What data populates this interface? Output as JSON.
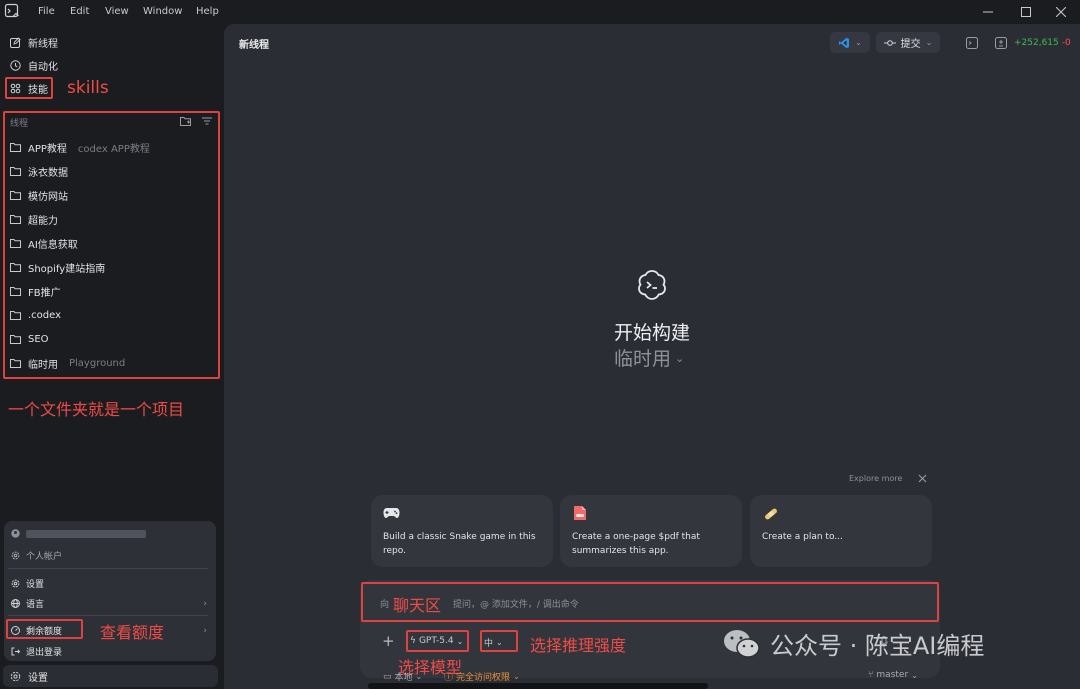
{
  "menubar": {
    "items": [
      "File",
      "Edit",
      "View",
      "Window",
      "Help"
    ]
  },
  "sidebar": {
    "nav": [
      {
        "label": "新线程",
        "icon": "edit-icon"
      },
      {
        "label": "自动化",
        "icon": "clock-icon"
      },
      {
        "label": "技能",
        "icon": "grid-icon"
      }
    ],
    "threads_header": "线程",
    "threads": [
      {
        "label": "APP教程",
        "sub": "codex APP教程"
      },
      {
        "label": "泳衣数据",
        "sub": ""
      },
      {
        "label": "模仿网站",
        "sub": ""
      },
      {
        "label": "超能力",
        "sub": ""
      },
      {
        "label": "AI信息获取",
        "sub": ""
      },
      {
        "label": "Shopify建站指南",
        "sub": ""
      },
      {
        "label": "FB推广",
        "sub": ""
      },
      {
        "label": ".codex",
        "sub": ""
      },
      {
        "label": "SEO",
        "sub": ""
      },
      {
        "label": "临时用",
        "sub": "Playground"
      }
    ],
    "popup": {
      "account_label": "个人帐户",
      "settings_label": "设置",
      "language_label": "语言",
      "quota_label": "剩余额度",
      "logout_label": "退出登录"
    },
    "footer_settings_label": "设置"
  },
  "header": {
    "title": "新线程",
    "commit_label": "提交",
    "diff_added": "+252,615",
    "diff_removed": "-0"
  },
  "hero": {
    "title": "开始构建",
    "project": "临时用"
  },
  "suggestions": {
    "explore_label": "Explore more",
    "cards": [
      {
        "icon": "gamepad-icon",
        "text": "Build a classic Snake game in this repo."
      },
      {
        "icon": "pdf-icon",
        "text": "Create a one-page $pdf that summarizes this app."
      },
      {
        "icon": "bandage-icon",
        "text": "Create a plan to..."
      }
    ]
  },
  "composer": {
    "placeholder_start": "向",
    "placeholder_rest": "提问，@ 添加文件，/ 调出命令",
    "model_label": "GPT-5.4",
    "effort_label": "中",
    "env_label": "本地",
    "access_label": "完全访问权限",
    "branch_label": "master"
  },
  "annotations": {
    "skills": "skills",
    "folder_note": "一个文件夹就是一个项目",
    "quota_note": "查看额度",
    "chat_note": "聊天区",
    "model_note": "选择模型",
    "effort_note": "选择推理强度"
  },
  "watermark": {
    "text": "公众号 · 陈宝AI编程"
  },
  "colors": {
    "accent_red": "#e0423f",
    "diff_added": "#3fb950",
    "diff_removed": "#f85149",
    "access_orange": "#e8913a"
  }
}
